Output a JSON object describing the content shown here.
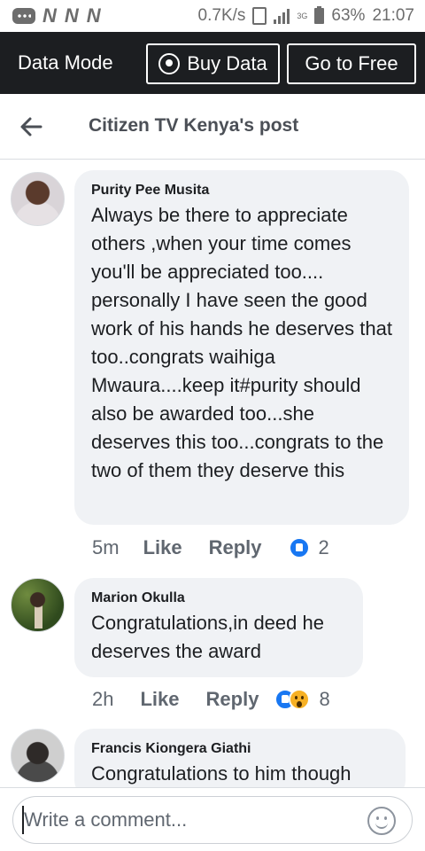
{
  "status_bar": {
    "carrier_glyphs": [
      "N",
      "N",
      "N"
    ],
    "network_speed": "0.7K/s",
    "network_type": "3G",
    "battery": "63%",
    "time": "21:07"
  },
  "data_banner": {
    "label": "Data Mode",
    "buy_data": "Buy Data",
    "go_to_free": "Go to Free"
  },
  "header": {
    "title": "Citizen TV Kenya's post"
  },
  "comments": [
    {
      "author": "Purity Pee Musita",
      "text": "Always be there to appreciate others ,when your time comes you'll be appreciated too.... personally I have seen the good work of his hands he deserves that too..congrats waihiga Mwaura....keep it#purity should also be awarded too...she deserves this too...congrats to the two of them they deserve this",
      "time": "5m",
      "like": "Like",
      "reply": "Reply",
      "reactions": [
        "like-icon"
      ],
      "reaction_count": "2"
    },
    {
      "author": "Marion Okulla",
      "text": "Congratulations,in deed he deserves the award",
      "time": "2h",
      "like": "Like",
      "reply": "Reply",
      "reactions": [
        "like-icon",
        "wow-icon"
      ],
      "reaction_count": "8"
    },
    {
      "author": "Francis Kiongera Giathi",
      "text": "Congratulations to him though"
    }
  ],
  "composer": {
    "placeholder": "Write a comment..."
  },
  "colors": {
    "banner_bg": "#1c1e21",
    "bubble_bg": "#f0f2f5",
    "like_blue": "#1877f2",
    "wow_yellow": "#f7b125",
    "secondary_text": "#606770"
  }
}
